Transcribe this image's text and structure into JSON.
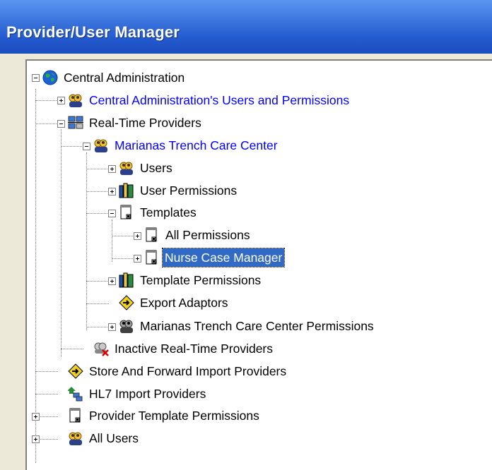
{
  "window": {
    "title": "Provider/User Manager"
  },
  "tree": [
    {
      "label": "Central Administration",
      "icon": "globe-icon"
    },
    {
      "label": "Central Administration's Users and Permissions",
      "icon": "users-icon",
      "color": "#0000ff"
    },
    {
      "label": "Real-Time Providers",
      "icon": "network-computers-icon"
    },
    {
      "label": "Marianas Trench Care Center",
      "icon": "users-icon",
      "color": "#0000ff"
    },
    {
      "label": "Users",
      "icon": "users-icon"
    },
    {
      "label": "User Permissions",
      "icon": "books-icon"
    },
    {
      "label": "Templates",
      "icon": "document-icon"
    },
    {
      "label": "All Permissions",
      "icon": "document-icon"
    },
    {
      "label": "Nurse Case Manager",
      "icon": "document-icon",
      "selected": true
    },
    {
      "label": "Template Permissions",
      "icon": "books-icon"
    },
    {
      "label": "Export Adaptors",
      "icon": "diamond-arrow-icon"
    },
    {
      "label": "Marianas Trench Care Center Permissions",
      "icon": "users-gray-icon"
    },
    {
      "label": "Inactive Real-Time Providers",
      "icon": "inactive-users-icon"
    },
    {
      "label": "Store And Forward Import Providers",
      "icon": "diamond-arrow-icon"
    },
    {
      "label": "HL7 Import Providers",
      "icon": "hl7-import-icon"
    },
    {
      "label": "Provider Template Permissions",
      "icon": "document-icon"
    },
    {
      "label": "All Users",
      "icon": "users-icon"
    }
  ],
  "colors": {
    "selection": "#316ac5",
    "link": "#0000ff",
    "titlebar": "#245bd0"
  }
}
